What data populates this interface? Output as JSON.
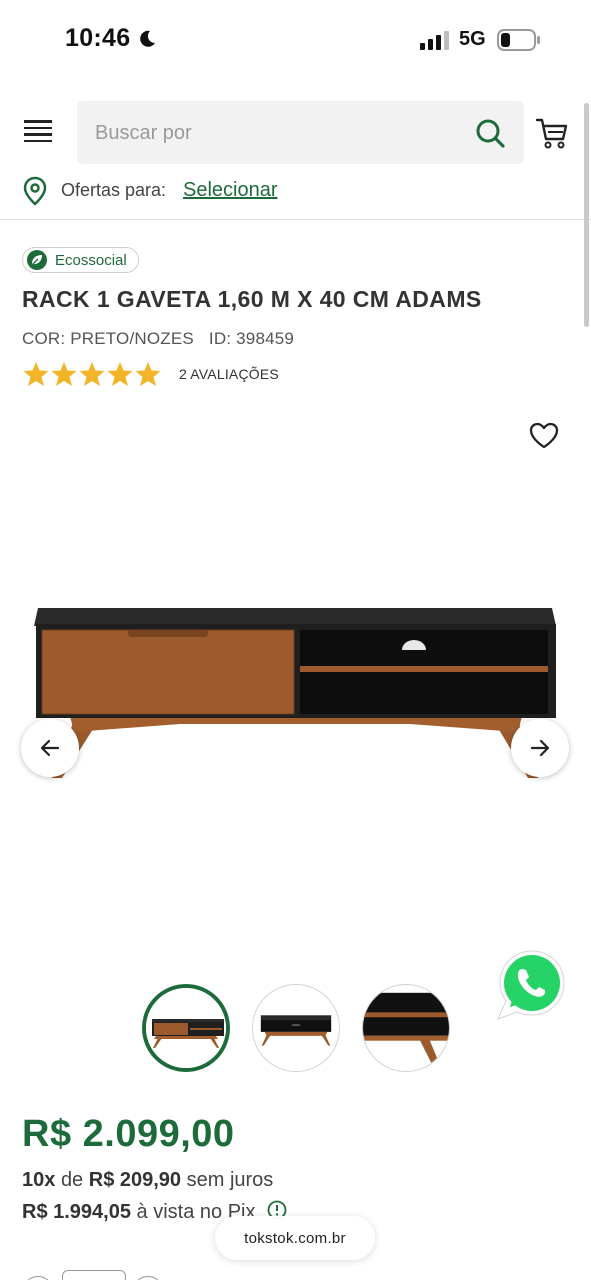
{
  "status_bar": {
    "time": "10:46",
    "network": "5G"
  },
  "header": {
    "search_placeholder": "Buscar por"
  },
  "location": {
    "label": "Ofertas para:",
    "link": "Selecionar"
  },
  "product": {
    "badge": "Ecossocial",
    "title": "RACK 1 GAVETA 1,60 M X 40 CM ADAMS",
    "color": "COR: PRETO/NOZES",
    "id": "ID: 398459",
    "rating": 5,
    "reviews": "2 AVALIAÇÕES"
  },
  "gallery": {
    "thumbnail_count": 3,
    "active_index": 0
  },
  "pricing": {
    "price": "R$ 2.099,00",
    "installment_count": "10x",
    "installment_of": "de",
    "installment_value": "R$ 209,90",
    "installment_suffix": "sem juros",
    "pix_value": "R$ 1.994,05",
    "pix_suffix": "à vista no Pix"
  },
  "browser": {
    "url": "tokstok.com.br"
  },
  "colors": {
    "brand_green": "#1d6b3a",
    "star_yellow": "#f2b527",
    "whatsapp_green": "#25d366"
  },
  "icons": [
    "moon-icon",
    "signal-icon",
    "battery-icon",
    "menu-icon",
    "search-icon",
    "cart-icon",
    "pin-icon",
    "leaf-icon",
    "star-icon",
    "heart-icon",
    "arrow-left-icon",
    "arrow-right-icon",
    "whatsapp-icon",
    "info-icon"
  ]
}
